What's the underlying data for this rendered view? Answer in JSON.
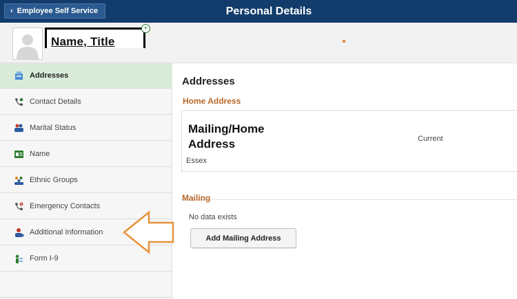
{
  "topbar": {
    "back_label": "Employee Self Service",
    "title": "Personal Details"
  },
  "profile": {
    "name_title": "Name, Title"
  },
  "sidebar": {
    "items": [
      {
        "label": "Addresses",
        "icon": "address-book-icon",
        "active": true
      },
      {
        "label": "Contact Details",
        "icon": "phone-icon",
        "active": false
      },
      {
        "label": "Marital Status",
        "icon": "people-icon",
        "active": false
      },
      {
        "label": "Name",
        "icon": "id-card-icon",
        "active": false
      },
      {
        "label": "Ethnic Groups",
        "icon": "group-icon",
        "active": false
      },
      {
        "label": "Emergency Contacts",
        "icon": "emergency-phone-icon",
        "active": false
      },
      {
        "label": "Additional Information",
        "icon": "person-icon",
        "active": false
      },
      {
        "label": "Form I-9",
        "icon": "form-icon",
        "active": false
      }
    ]
  },
  "main": {
    "title": "Addresses",
    "home_heading": "Home Address",
    "home_card": {
      "type": "Mailing/Home Address",
      "status": "Current",
      "line": "Essex"
    },
    "mailing_heading": "Mailing",
    "mailing_empty": "No data exists",
    "add_button": "Add Mailing Address"
  },
  "colors": {
    "topbar": "#123c6b",
    "active_item": "#d9ecd9",
    "subheading": "#b8682a",
    "arrow": "#e8913a"
  }
}
